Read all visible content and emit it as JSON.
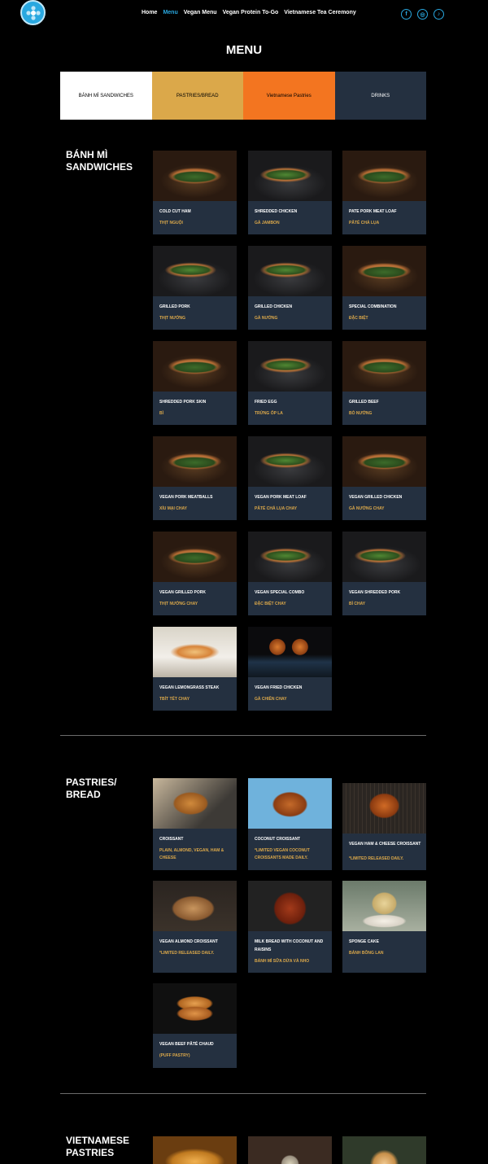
{
  "nav": {
    "items": [
      {
        "label": "Home"
      },
      {
        "label": "Menu"
      },
      {
        "label": "Vegan Menu"
      },
      {
        "label": "Vegan Protein To-Go"
      },
      {
        "label": "Vietnamese Tea Ceremony"
      }
    ],
    "active_index": 1,
    "social": [
      {
        "icon": "facebook-icon",
        "glyph": "f"
      },
      {
        "icon": "instagram-icon",
        "glyph": "◎"
      },
      {
        "icon": "tiktok-icon",
        "glyph": "♪"
      }
    ]
  },
  "page_title": "MENU",
  "tabs": [
    {
      "label": "BÁNH MÌ SANDWICHES"
    },
    {
      "label": "PASTRIES/BREAD"
    },
    {
      "label": "Vietnamese Pastries"
    },
    {
      "label": "DRINKS"
    }
  ],
  "sections": {
    "banh_mi": {
      "title": "BÁNH MÌ SANDWICHES",
      "items": [
        {
          "name": "COLD CUT HAM",
          "sub": "THỊT NGUỘI"
        },
        {
          "name": "SHREDDED CHICKEN",
          "sub": "GÀ JAMBON"
        },
        {
          "name": "PATE PORK MEAT LOAF",
          "sub": "PÂTÉ CHẢ LỤA"
        },
        {
          "name": "GRILLED PORK",
          "sub": "THỊT NƯỚNG"
        },
        {
          "name": "GRILLED CHICKEN",
          "sub": "GÀ NƯỚNG"
        },
        {
          "name": "SPECIAL COMBINATION",
          "sub": "ĐẶC BIỆT"
        },
        {
          "name": "SHREDDED PORK SKIN",
          "sub": "BÌ"
        },
        {
          "name": "FRIED EGG",
          "sub": "TRỨNG ỐP LA"
        },
        {
          "name": "GRILLED BEEF",
          "sub": "BÒ NƯỚNG"
        },
        {
          "name": "VEGAN PORK MEATBALLS",
          "sub": "XÍU MẠI CHAY"
        },
        {
          "name": "VEGAN PORK MEAT LOAF",
          "sub": "PÂTÉ CHẢ LỤA CHAY"
        },
        {
          "name": "VEGAN GRILLED CHICKEN",
          "sub": "GÀ NƯỚNG CHAY"
        },
        {
          "name": "VEGAN GRILLED PORK",
          "sub": "THỊT NƯỚNG CHAY"
        },
        {
          "name": "VEGAN SPECIAL COMBO",
          "sub": "ĐẶC BIỆT CHAY"
        },
        {
          "name": "VEGAN SHREDDED PORK",
          "sub": "BÌ CHAY"
        },
        {
          "name": "VEGAN LEMONGRASS STEAK",
          "sub": "TBÍT TẾT CHAY"
        },
        {
          "name": "VEGAN FRIED CHICKEN",
          "sub": "GÀ CHIÊN CHAY"
        }
      ]
    },
    "pastries": {
      "title": "PASTRIES/ BREAD",
      "items": [
        {
          "name": "CROISSANT",
          "sub": "PLAIN, ALMOND, VEGAN, HAM & CHEESE"
        },
        {
          "name": "COCONUT CROISSANT",
          "sub": "*LIMITED VEGAN COCONUT CROISSANTS MADE DAILY."
        },
        {
          "name": "VEGAN HAM & CHEESE CROISSANT",
          "sub": "*LIMITED RELEASED DAILY."
        },
        {
          "name": "VEGAN ALMOND CROISSANT",
          "sub": "*LIMITED RELEASED DAILY."
        },
        {
          "name": "MILK BREAD WITH COCONUT AND RAISINS",
          "sub": "BÁNH MÌ SỮA DỪA VÀ NHO"
        },
        {
          "name": "SPONGE CAKE",
          "sub": "BÁNH BÔNG LAN"
        },
        {
          "name": "VEGAN BEEF PÂTÉ CHAUD",
          "sub": "(PUFF PASTRY)"
        }
      ]
    },
    "viet_pastries": {
      "title": "VIETNAMESE PASTRIES"
    }
  }
}
